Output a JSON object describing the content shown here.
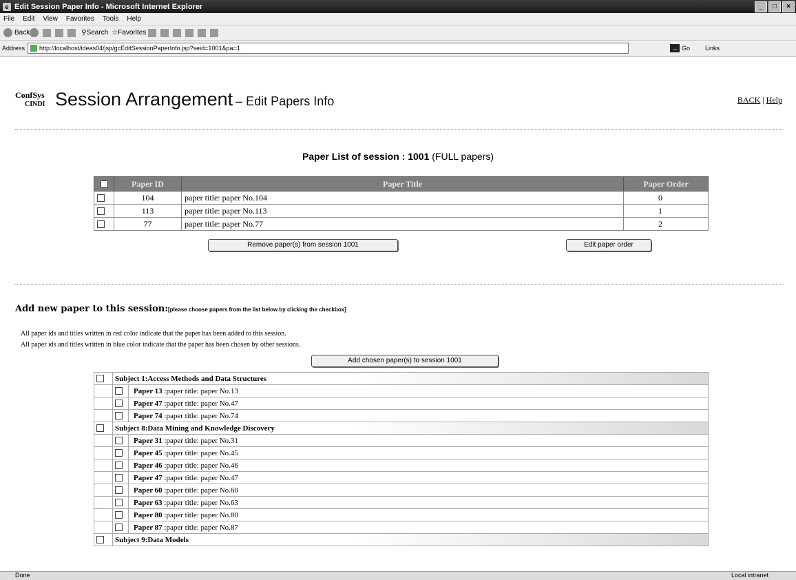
{
  "window": {
    "title": "Edit Session Paper Info - Microsoft Internet Explorer",
    "menu": [
      "File",
      "Edit",
      "View",
      "Favorites",
      "Tools",
      "Help"
    ],
    "toolbar": {
      "back": "Back",
      "search": "Search",
      "favorites": "Favorites"
    },
    "address_label": "Address",
    "url": "http://localhost/ideas04/jsp/gcEditSessionPaperInfo.jsp?seid=1001&pa=1",
    "go": "Go",
    "links": "Links"
  },
  "header": {
    "logo_line1": "ConfSys",
    "logo_line2": "CINDI",
    "title": "Session Arrangement",
    "subtitle": "– Edit Papers Info",
    "back_link": "BACK",
    "separator": "|",
    "help_link": "Help"
  },
  "session_list": {
    "caption": "Paper List of session : 1001",
    "caption_suffix": "(FULL papers)",
    "columns": [
      "Paper ID",
      "Paper Title",
      "Paper Order"
    ],
    "rows": [
      {
        "id": "104",
        "title": "paper title: paper No.104",
        "order": "0"
      },
      {
        "id": "113",
        "title": "paper title: paper No.113",
        "order": "1"
      },
      {
        "id": "77",
        "title": "paper title: paper No.77",
        "order": "2"
      }
    ],
    "remove_button": "Remove paper(s) from session 1001",
    "edit_order_button": "Edit paper order"
  },
  "add_section": {
    "heading": "Add new paper to this session:",
    "note": "[please choose papers from the list below by clicking the checkbox]",
    "legend_red": "All paper ids and titles written in red color indicate that the paper has been added to this session.",
    "legend_blue": "All paper ids and titles written in blue color indicate that the paper has been chosen by other sessions.",
    "add_button": "Add chosen paper(s) to session 1001"
  },
  "subjects": [
    {
      "label": "Subject 1:Access Methods and Data Structures",
      "papers": [
        {
          "num": "Paper 13",
          "title": ":paper title: paper No.13"
        },
        {
          "num": "Paper 47",
          "title": ":paper title: paper No.47"
        },
        {
          "num": "Paper 74",
          "title": ":paper title: paper No.74"
        }
      ]
    },
    {
      "label": "Subject 8:Data Mining and Knowledge Discovery",
      "papers": [
        {
          "num": "Paper 31",
          "title": ":paper title: paper No.31"
        },
        {
          "num": "Paper 45",
          "title": ":paper title: paper No.45"
        },
        {
          "num": "Paper 46",
          "title": ":paper title: paper No.46"
        },
        {
          "num": "Paper 47",
          "title": ":paper title: paper No.47"
        },
        {
          "num": "Paper 60",
          "title": ":paper title: paper No.60"
        },
        {
          "num": "Paper 63",
          "title": ":paper title: paper No.63"
        },
        {
          "num": "Paper 80",
          "title": ":paper title: paper No.80"
        },
        {
          "num": "Paper 87",
          "title": ":paper title: paper No.87"
        }
      ]
    },
    {
      "label": "Subject 9:Data Models",
      "papers": []
    }
  ],
  "status": {
    "left": "Done",
    "right": "Local intranet"
  }
}
